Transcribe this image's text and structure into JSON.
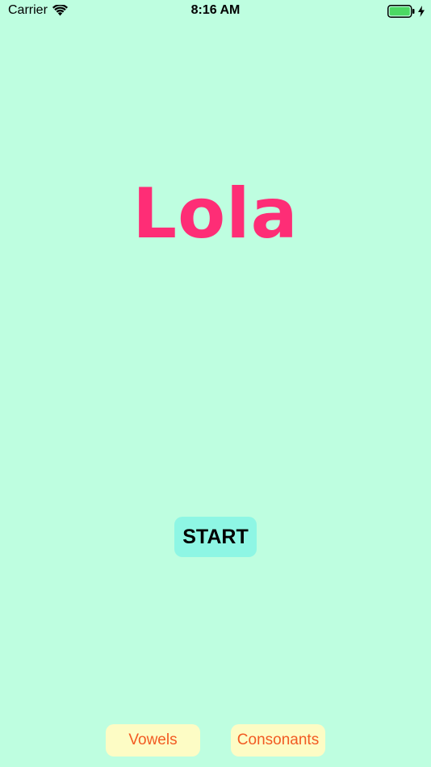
{
  "status_bar": {
    "carrier": "Carrier",
    "time": "8:16 AM",
    "wifi_icon": "wifi-icon",
    "battery_icon": "battery-full-icon",
    "charging_icon": "charging-bolt-icon",
    "battery_color": "#4cd964"
  },
  "main": {
    "title": "Lola",
    "title_color": "#fe2d76",
    "start_label": "START"
  },
  "bottom_buttons": {
    "vowels_label": "Vowels",
    "consonants_label": "Consonants",
    "text_color": "#f25a22",
    "background_color": "#fdfcc5"
  },
  "colors": {
    "background": "#befee0",
    "start_button": "#8ef6e4"
  }
}
